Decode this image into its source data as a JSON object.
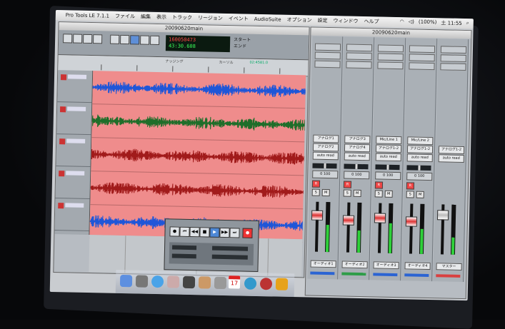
{
  "menubar": {
    "app": "Pro Tools LE 7.1.1",
    "items": [
      "ファイル",
      "編集",
      "表示",
      "トラック",
      "リージョン",
      "イベント",
      "AudioSuite",
      "オプション",
      "設定",
      "ウィンドウ",
      "ヘルプ"
    ],
    "battery": "(100%)",
    "clock": "土 11:55"
  },
  "edit_window": {
    "title": "20090620main",
    "counter_main": "160050473",
    "counter_sub": "43:30.608",
    "label_start": "スタート",
    "label_end": "エンド",
    "label_nudge": "ナッジング",
    "label_cursor": "カーソル",
    "cursor_value": "02:4581.0"
  },
  "mix_window": {
    "title": "20090620main",
    "strips": [
      {
        "io1": "アナログ1",
        "io2": "アナログ2",
        "auto": "auto read",
        "pan": "0 100",
        "name": "オーディオ1",
        "color": "#2b64d3"
      },
      {
        "io1": "アナログ3",
        "io2": "アナログ4",
        "auto": "auto read",
        "pan": "0 100",
        "name": "オーディオ2",
        "color": "#2e9d48"
      },
      {
        "io1": "Mic/Line 1",
        "io2": "アナログ1-2",
        "auto": "auto read",
        "pan": "0 100",
        "name": "オーディオ3",
        "color": "#2b64d3"
      },
      {
        "io1": "Mic/Line 2",
        "io2": "アナログ1-2",
        "auto": "auto read",
        "pan": "0 100",
        "name": "オーディオ4",
        "color": "#2b64d3"
      },
      {
        "io1": "",
        "io2": "アナログ1-2",
        "auto": "auto read",
        "pan": "",
        "name": "マスター",
        "color": "#d94040"
      }
    ]
  },
  "dock": {
    "calendar_day": "17"
  },
  "colors": {
    "track_bg": "#ef8c8c",
    "wave_blue": "#1f56d8",
    "wave_green": "#1f6e2a",
    "wave_red": "#a11b1b",
    "counter_green": "#3dff5b"
  }
}
